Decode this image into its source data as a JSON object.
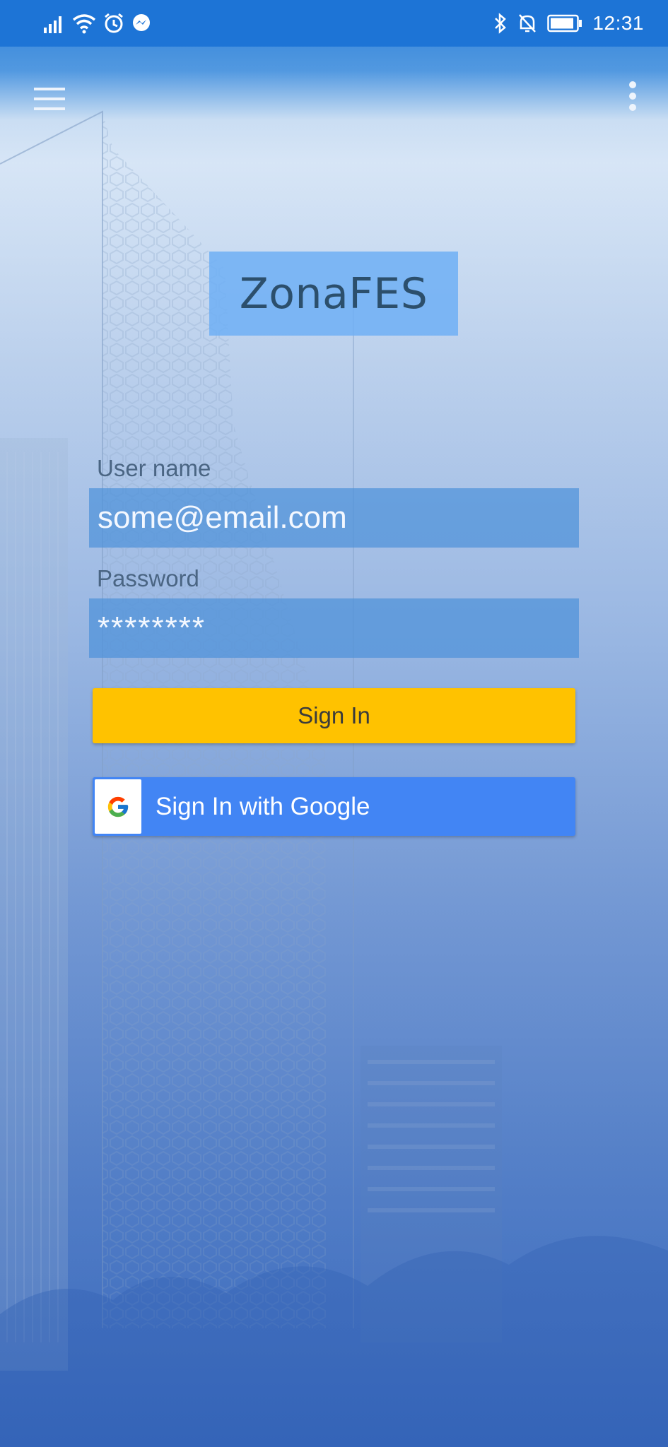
{
  "status_bar": {
    "time": "12:31",
    "left_icons": [
      "signal-icon",
      "wifi-icon",
      "alarm-icon",
      "messenger-icon"
    ],
    "right_icons": [
      "bluetooth-icon",
      "notifications-off-icon",
      "battery-icon"
    ]
  },
  "toolbar": {
    "menu_icon": "hamburger-menu-icon",
    "more_icon": "more-vert-icon"
  },
  "app": {
    "logo_text": "ZonaFES"
  },
  "login_form": {
    "username_label": "User name",
    "username_value": "some@email.com",
    "password_label": "Password",
    "password_value": "********",
    "sign_in_label": "Sign In",
    "google_sign_in_label": "Sign In with Google"
  },
  "colors": {
    "status_bar": "#1d74d6",
    "sign_in_button": "#ffc200",
    "google_button": "#4285f4",
    "input_background": "#4e91da"
  }
}
